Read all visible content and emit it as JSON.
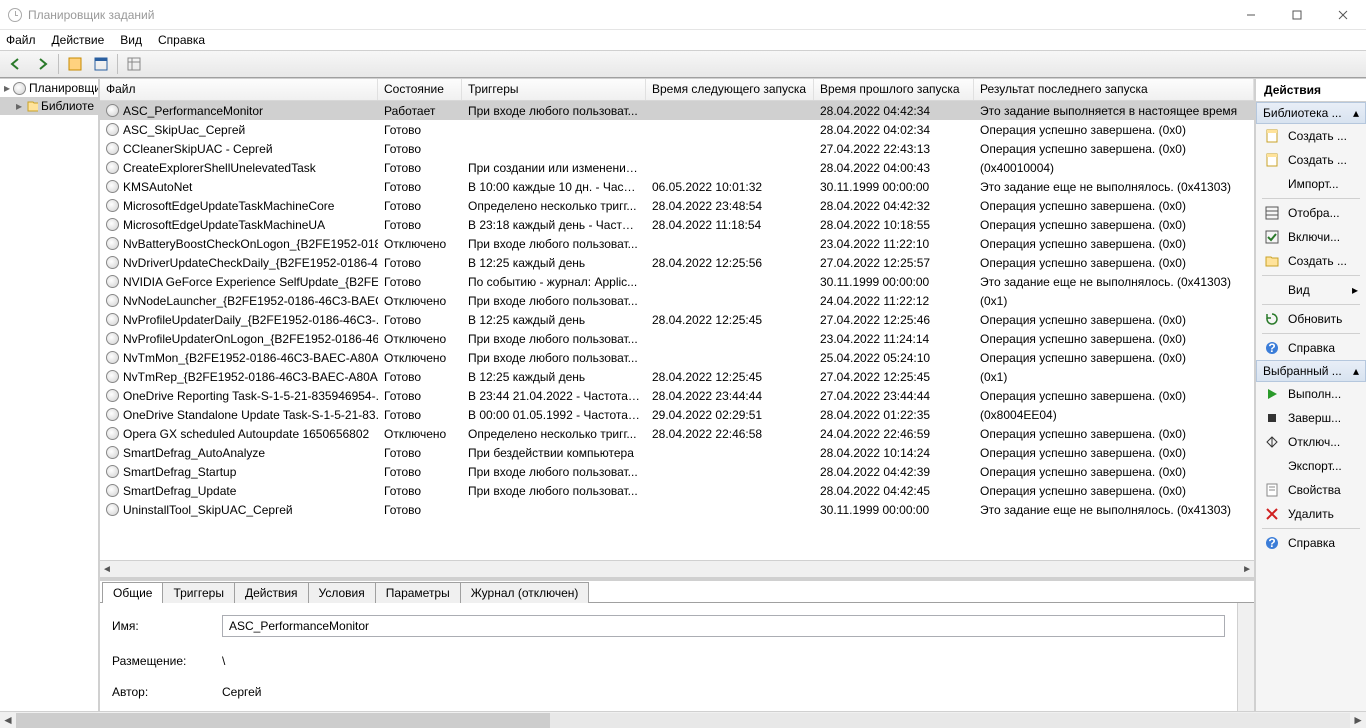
{
  "window": {
    "title": "Планировщик заданий"
  },
  "menu": {
    "file": "Файл",
    "action": "Действие",
    "view": "Вид",
    "help": "Справка"
  },
  "tree": {
    "root": "Планировщи",
    "lib": "Библиоте"
  },
  "columns": {
    "file": "Файл",
    "state": "Состояние",
    "triggers": "Триггеры",
    "next": "Время следующего запуска",
    "last": "Время прошлого запуска",
    "result": "Результат последнего запуска"
  },
  "tasks": [
    {
      "name": "ASC_PerformanceMonitor",
      "state": "Работает",
      "trig": "При входе любого пользоват...",
      "next": "",
      "last": "28.04.2022 04:42:34",
      "res": "Это задание выполняется в настоящее время",
      "sel": true
    },
    {
      "name": "ASC_SkipUac_Сергей",
      "state": "Готово",
      "trig": "",
      "next": "",
      "last": "28.04.2022 04:02:34",
      "res": "Операция успешно завершена. (0x0)"
    },
    {
      "name": "CCleanerSkipUAC - Сергей",
      "state": "Готово",
      "trig": "",
      "next": "",
      "last": "27.04.2022 22:43:13",
      "res": "Операция успешно завершена. (0x0)"
    },
    {
      "name": "CreateExplorerShellUnelevatedTask",
      "state": "Готово",
      "trig": "При создании или изменении...",
      "next": "",
      "last": "28.04.2022 04:00:43",
      "res": "(0x40010004)"
    },
    {
      "name": "KMSAutoNet",
      "state": "Готово",
      "trig": "В 10:00 каждые 10 дн. - Частот...",
      "next": "06.05.2022 10:01:32",
      "last": "30.11.1999 00:00:00",
      "res": "Это задание еще не выполнялось. (0x41303)"
    },
    {
      "name": "MicrosoftEdgeUpdateTaskMachineCore",
      "state": "Готово",
      "trig": "Определено несколько тригг...",
      "next": "28.04.2022 23:48:54",
      "last": "28.04.2022 04:42:32",
      "res": "Операция успешно завершена. (0x0)"
    },
    {
      "name": "MicrosoftEdgeUpdateTaskMachineUA",
      "state": "Готово",
      "trig": "В 23:18 каждый день - Частота...",
      "next": "28.04.2022 11:18:54",
      "last": "28.04.2022 10:18:55",
      "res": "Операция успешно завершена. (0x0)"
    },
    {
      "name": "NvBatteryBoostCheckOnLogon_{B2FE1952-018...",
      "state": "Отключено",
      "trig": "При входе любого пользоват...",
      "next": "",
      "last": "23.04.2022 11:22:10",
      "res": "Операция успешно завершена. (0x0)"
    },
    {
      "name": "NvDriverUpdateCheckDaily_{B2FE1952-0186-4...",
      "state": "Готово",
      "trig": "В 12:25 каждый день",
      "next": "28.04.2022 12:25:56",
      "last": "27.04.2022 12:25:57",
      "res": "Операция успешно завершена. (0x0)"
    },
    {
      "name": "NVIDIA GeForce Experience SelfUpdate_{B2FE1...",
      "state": "Готово",
      "trig": "По событию - журнал: Applic...",
      "next": "",
      "last": "30.11.1999 00:00:00",
      "res": "Это задание еще не выполнялось. (0x41303)"
    },
    {
      "name": "NvNodeLauncher_{B2FE1952-0186-46C3-BAEC...",
      "state": "Отключено",
      "trig": "При входе любого пользоват...",
      "next": "",
      "last": "24.04.2022 11:22:12",
      "res": "(0x1)"
    },
    {
      "name": "NvProfileUpdaterDaily_{B2FE1952-0186-46C3-...",
      "state": "Готово",
      "trig": "В 12:25 каждый день",
      "next": "28.04.2022 12:25:45",
      "last": "27.04.2022 12:25:46",
      "res": "Операция успешно завершена. (0x0)"
    },
    {
      "name": "NvProfileUpdaterOnLogon_{B2FE1952-0186-46...",
      "state": "Отключено",
      "trig": "При входе любого пользоват...",
      "next": "",
      "last": "23.04.2022 11:24:14",
      "res": "Операция успешно завершена. (0x0)"
    },
    {
      "name": "NvTmMon_{B2FE1952-0186-46C3-BAEC-A80A...",
      "state": "Отключено",
      "trig": "При входе любого пользоват...",
      "next": "",
      "last": "25.04.2022 05:24:10",
      "res": "Операция успешно завершена. (0x0)"
    },
    {
      "name": "NvTmRep_{B2FE1952-0186-46C3-BAEC-A80AA...",
      "state": "Готово",
      "trig": "В 12:25 каждый день",
      "next": "28.04.2022 12:25:45",
      "last": "27.04.2022 12:25:45",
      "res": "(0x1)"
    },
    {
      "name": "OneDrive Reporting Task-S-1-5-21-835946954-...",
      "state": "Готово",
      "trig": "В 23:44 21.04.2022 - Частота по...",
      "next": "28.04.2022 23:44:44",
      "last": "27.04.2022 23:44:44",
      "res": "Операция успешно завершена. (0x0)"
    },
    {
      "name": "OneDrive Standalone Update Task-S-1-5-21-83...",
      "state": "Готово",
      "trig": "В 00:00 01.05.1992 - Частота по...",
      "next": "29.04.2022 02:29:51",
      "last": "28.04.2022 01:22:35",
      "res": "(0x8004EE04)"
    },
    {
      "name": "Opera GX scheduled Autoupdate 1650656802",
      "state": "Отключено",
      "trig": "Определено несколько тригг...",
      "next": "28.04.2022 22:46:58",
      "last": "24.04.2022 22:46:59",
      "res": "Операция успешно завершена. (0x0)"
    },
    {
      "name": "SmartDefrag_AutoAnalyze",
      "state": "Готово",
      "trig": "При бездействии компьютера",
      "next": "",
      "last": "28.04.2022 10:14:24",
      "res": "Операция успешно завершена. (0x0)"
    },
    {
      "name": "SmartDefrag_Startup",
      "state": "Готово",
      "trig": "При входе любого пользоват...",
      "next": "",
      "last": "28.04.2022 04:42:39",
      "res": "Операция успешно завершена. (0x0)"
    },
    {
      "name": "SmartDefrag_Update",
      "state": "Готово",
      "trig": "При входе любого пользоват...",
      "next": "",
      "last": "28.04.2022 04:42:45",
      "res": "Операция успешно завершена. (0x0)"
    },
    {
      "name": "UninstallTool_SkipUAC_Сергей",
      "state": "Готово",
      "trig": "",
      "next": "",
      "last": "30.11.1999 00:00:00",
      "res": "Это задание еще не выполнялось. (0x41303)"
    }
  ],
  "tabs": {
    "general": "Общие",
    "triggers": "Триггеры",
    "actions": "Действия",
    "conditions": "Условия",
    "params": "Параметры",
    "journal": "Журнал (отключен)"
  },
  "details": {
    "name_label": "Имя:",
    "name_value": "ASC_PerformanceMonitor",
    "location_label": "Размещение:",
    "location_value": "\\",
    "author_label": "Автор:",
    "author_value": "Сергей"
  },
  "actions": {
    "title": "Действия",
    "section1": "Библиотека ...",
    "lib_items": [
      {
        "label": "Создать ...",
        "icon": "doc"
      },
      {
        "label": "Создать ...",
        "icon": "doc"
      },
      {
        "label": "Импорт...",
        "icon": "none"
      },
      {
        "label": "Отобра...",
        "icon": "grid"
      },
      {
        "label": "Включи...",
        "icon": "check"
      },
      {
        "label": "Создать ...",
        "icon": "folder"
      },
      {
        "label": "Вид",
        "icon": "none",
        "arrow": true
      },
      {
        "label": "Обновить",
        "icon": "refresh"
      },
      {
        "label": "Справка",
        "icon": "help"
      }
    ],
    "section2": "Выбранный ...",
    "sel_items": [
      {
        "label": "Выполн...",
        "icon": "play"
      },
      {
        "label": "Заверш...",
        "icon": "stop"
      },
      {
        "label": "Отключ...",
        "icon": "disable"
      },
      {
        "label": "Экспорт...",
        "icon": "none"
      },
      {
        "label": "Свойства",
        "icon": "props"
      },
      {
        "label": "Удалить",
        "icon": "delete"
      },
      {
        "label": "Справка",
        "icon": "help"
      }
    ]
  }
}
